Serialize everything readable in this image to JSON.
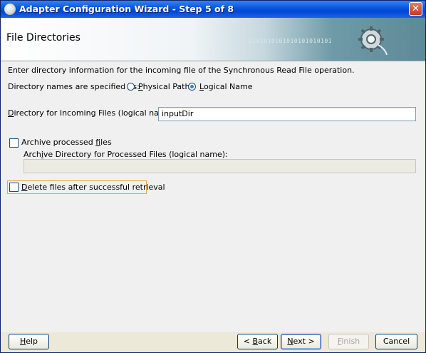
{
  "window": {
    "title": "Adapter Configuration Wizard - Step 5 of 8",
    "close_label": "✕"
  },
  "banner": {
    "title": "File Directories",
    "decor_bits": "0101010101010101010101"
  },
  "content": {
    "intro": "Enter directory information for the incoming file of the Synchronous Read File operation.",
    "dir_names_label": "Directory names are specified as:",
    "radio_physical": {
      "mnemonic": "P",
      "rest": "hysical Path",
      "selected": false
    },
    "radio_logical": {
      "mnemonic": "L",
      "rest": "ogical Name",
      "selected": true
    },
    "incoming_label": {
      "mnemonic": "D",
      "rest": "irectory for Incoming Files (logical name):"
    },
    "incoming_value": "inputDir",
    "archive_checkbox": {
      "prefix": "Archive processed ",
      "mnemonic": "f",
      "suffix": "iles",
      "checked": false
    },
    "archive_dir_label": {
      "prefix": "Arch",
      "mnemonic": "i",
      "suffix": "ve Directory for Processed Files (logical name):"
    },
    "archive_dir_value": "",
    "delete_checkbox": {
      "mnemonic": "D",
      "rest": "elete files after successful retrieval",
      "checked": false
    }
  },
  "buttons": {
    "help": {
      "mnemonic": "H",
      "rest": "elp"
    },
    "back": {
      "prefix": "< ",
      "mnemonic": "B",
      "rest": "ack"
    },
    "next": {
      "mnemonic": "N",
      "rest": "ext >"
    },
    "finish": {
      "mnemonic": "F",
      "rest": "inish"
    },
    "cancel": "Cancel"
  },
  "colors": {
    "titlebar": "#0a5ae0",
    "focus_outline": "#e8a84a",
    "radio_dot": "#3a7fd0"
  }
}
